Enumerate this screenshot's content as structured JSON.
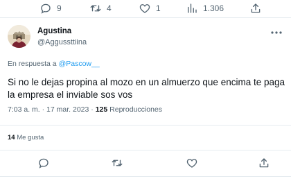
{
  "prev_tweet_actions": {
    "reply_count": "9",
    "retweet_count": "4",
    "like_count": "1",
    "view_count": "1.306"
  },
  "tweet": {
    "author_name": "Agustina",
    "author_handle": "@Aggussttiina",
    "reply_prefix": "En respuesta a",
    "reply_to": "@Pascow__",
    "text": "Si no le dejas propina al mozo en un almuerzo que encima te paga la empresa el inviable sos vos",
    "time": "7:03 a. m.",
    "separator": "·",
    "date": "17 mar. 2023",
    "views_count": "125",
    "views_label": "Reproducciones",
    "likes_count": "14",
    "likes_label": "Me gusta"
  },
  "icons": {
    "reply": "reply-bubble-icon",
    "retweet": "retweet-icon",
    "like": "heart-icon",
    "views": "analytics-bars-icon",
    "share": "share-upload-icon",
    "more": "more-dots-icon"
  },
  "colors": {
    "accent": "#1d9bf0",
    "text_primary": "#0f1419",
    "text_secondary": "#536471",
    "divider": "#e6ecf0"
  }
}
